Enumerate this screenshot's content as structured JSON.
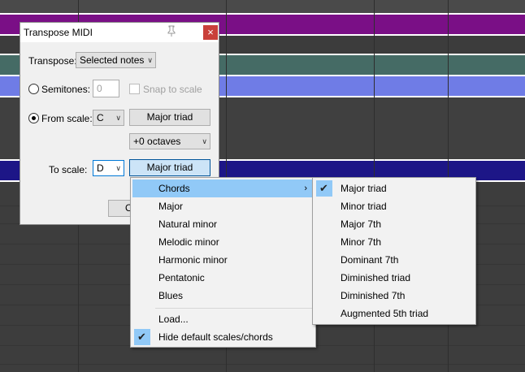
{
  "window": {
    "title": "Transpose MIDI",
    "close_glyph": "×",
    "pin_icon": "pin-icon"
  },
  "form": {
    "transpose_label": "Transpose:",
    "transpose_value": "Selected notes",
    "semitones_label": "Semitones:",
    "semitones_value": "0",
    "snap_label": "Snap to scale",
    "from_scale_label": "From scale:",
    "from_key": "C",
    "from_chord": "Major triad",
    "octaves": "+0 octaves",
    "to_scale_label": "To scale:",
    "to_key": "D",
    "to_chord": "Major triad",
    "ok_partial": "O"
  },
  "menu": {
    "items": [
      {
        "label": "Chords",
        "submenu": true,
        "highlighted": true
      },
      {
        "label": "Major"
      },
      {
        "label": "Natural minor"
      },
      {
        "label": "Melodic minor"
      },
      {
        "label": "Harmonic minor"
      },
      {
        "label": "Pentatonic"
      },
      {
        "label": "Blues"
      },
      {
        "label": "Load..."
      },
      {
        "label": "Hide default scales/chords",
        "checked": true
      }
    ],
    "submenu_arrow": "›"
  },
  "submenu": {
    "items": [
      {
        "label": "Major triad",
        "checked": true
      },
      {
        "label": "Minor triad"
      },
      {
        "label": "Major 7th"
      },
      {
        "label": "Minor 7th"
      },
      {
        "label": "Dominant 7th"
      },
      {
        "label": "Diminished triad"
      },
      {
        "label": "Diminished 7th"
      },
      {
        "label": "Augmented 5th triad"
      }
    ]
  },
  "colors": {
    "accent": "#91c9f7",
    "lane_purple": "#7a0f86",
    "lane_teal": "#456b65",
    "lane_blue": "#6f7ce6",
    "lane_navy": "#1d1687",
    "background": "#424242"
  }
}
